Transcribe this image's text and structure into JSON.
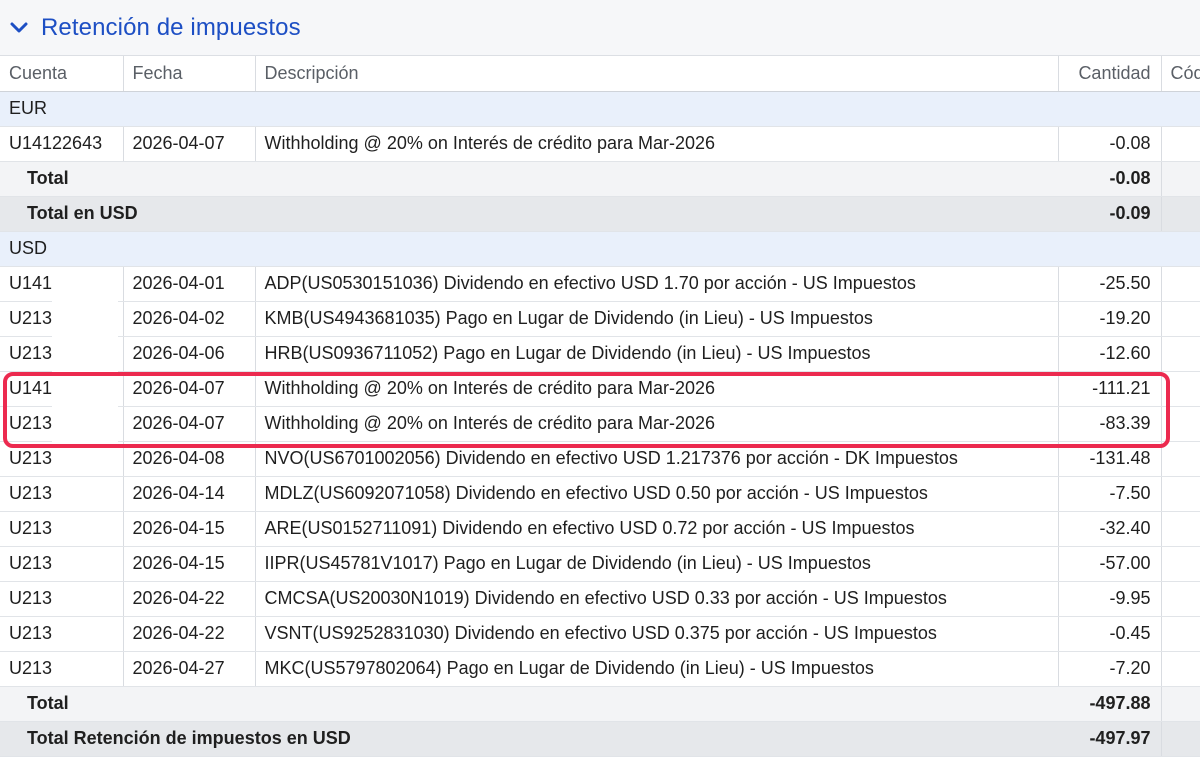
{
  "section": {
    "title": "Retención de impuestos",
    "icon": "chevron-down-icon",
    "accent": "#1d4fc4"
  },
  "columns": {
    "cuenta": "Cuenta",
    "fecha": "Fecha",
    "descripcion": "Descripción",
    "cantidad": "Cantidad",
    "codigo": "Cód"
  },
  "eur": {
    "currency": "EUR",
    "rows": [
      {
        "cuenta": "U14122643",
        "fecha": "2026-04-07",
        "descripcion": "Withholding @ 20% on Interés de crédito para Mar-2026",
        "cantidad": "-0.08"
      }
    ],
    "total_label": "Total",
    "total_value": "-0.08",
    "total_usd_label": "Total en USD",
    "total_usd_value": "-0.09"
  },
  "usd": {
    "currency": "USD",
    "rows": [
      {
        "cuenta": "U141",
        "fecha": "2026-04-01",
        "descripcion": "ADP(US0530151036) Dividendo en efectivo USD 1.70 por acción - US Impuestos",
        "cantidad": "-25.50"
      },
      {
        "cuenta": "U213",
        "fecha": "2026-04-02",
        "descripcion": "KMB(US4943681035) Pago en Lugar de Dividendo (in Lieu) - US Impuestos",
        "cantidad": "-19.20"
      },
      {
        "cuenta": "U213",
        "fecha": "2026-04-06",
        "descripcion": "HRB(US0936711052) Pago en Lugar de Dividendo (in Lieu) - US Impuestos",
        "cantidad": "-12.60"
      },
      {
        "cuenta": "U141",
        "fecha": "2026-04-07",
        "descripcion": "Withholding @ 20% on Interés de crédito para Mar-2026",
        "cantidad": "-111.21"
      },
      {
        "cuenta": "U213",
        "fecha": "2026-04-07",
        "descripcion": "Withholding @ 20% on Interés de crédito para Mar-2026",
        "cantidad": "-83.39"
      },
      {
        "cuenta": "U213",
        "fecha": "2026-04-08",
        "descripcion": "NVO(US6701002056) Dividendo en efectivo USD 1.217376 por acción - DK Impuestos",
        "cantidad": "-131.48"
      },
      {
        "cuenta": "U213",
        "fecha": "2026-04-14",
        "descripcion": "MDLZ(US6092071058) Dividendo en efectivo USD 0.50 por acción - US Impuestos",
        "cantidad": "-7.50"
      },
      {
        "cuenta": "U213",
        "fecha": "2026-04-15",
        "descripcion": "ARE(US0152711091) Dividendo en efectivo USD 0.72 por acción - US Impuestos",
        "cantidad": "-32.40"
      },
      {
        "cuenta": "U213",
        "fecha": "2026-04-15",
        "descripcion": "IIPR(US45781V1017) Pago en Lugar de Dividendo (in Lieu) - US Impuestos",
        "cantidad": "-57.00"
      },
      {
        "cuenta": "U213",
        "fecha": "2026-04-22",
        "descripcion": "CMCSA(US20030N1019) Dividendo en efectivo USD 0.33 por acción - US Impuestos",
        "cantidad": "-9.95"
      },
      {
        "cuenta": "U213",
        "fecha": "2026-04-22",
        "descripcion": "VSNT(US9252831030) Dividendo en efectivo USD 0.375 por acción - US Impuestos",
        "cantidad": "-0.45"
      },
      {
        "cuenta": "U213",
        "fecha": "2026-04-27",
        "descripcion": "MKC(US5797802064) Pago en Lugar de Dividendo (in Lieu) - US Impuestos",
        "cantidad": "-7.20"
      }
    ],
    "total_label": "Total",
    "total_value": "-497.88"
  },
  "grand_total": {
    "label": "Total Retención de impuestos en USD",
    "value": "-497.97"
  },
  "colors": {
    "currency_row_bg": "#e9f0fb",
    "total_row_bg": "#f3f4f6",
    "grand_total_bg": "#e6e8eb",
    "highlight": "#ec2a4f"
  }
}
